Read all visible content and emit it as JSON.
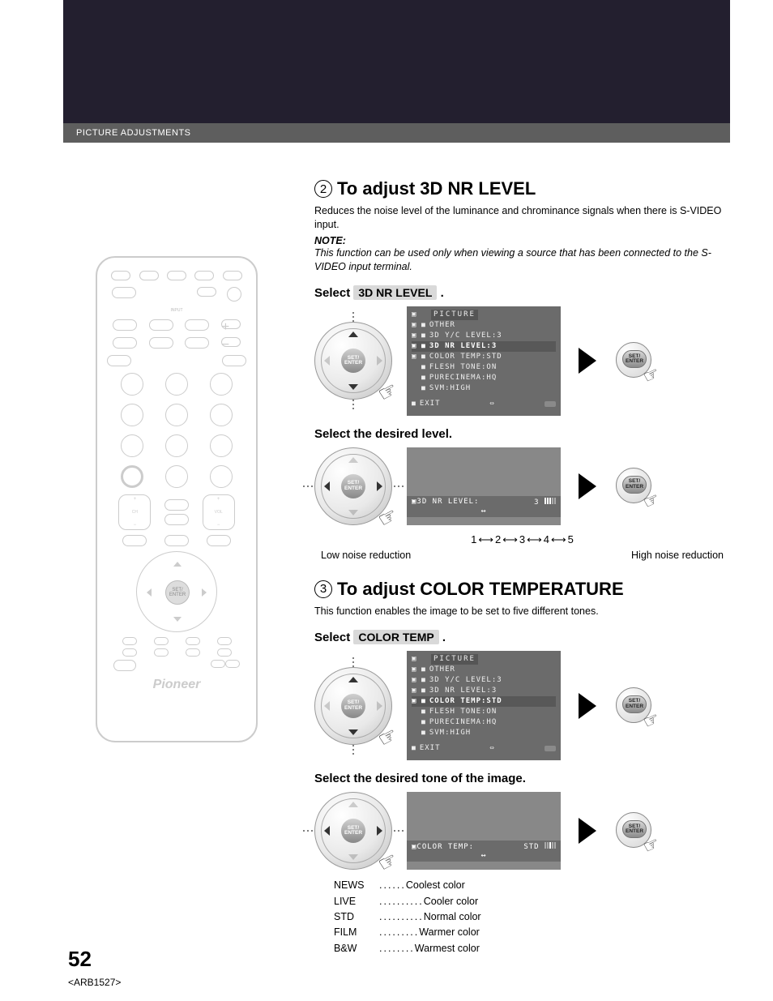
{
  "header": {
    "breadcrumb": "PICTURE ADJUSTMENTS"
  },
  "remote": {
    "brand": "Pioneer",
    "dpad_center": "SET/\nENTER"
  },
  "section2": {
    "num": "2",
    "title": "To adjust 3D NR LEVEL",
    "body": "Reduces the noise level of the luminance and chrominance signals when there is S-VIDEO input.",
    "note_label": "NOTE:",
    "note_body": "This function can be used only when viewing a source that has been connected to the S-VIDEO input terminal.",
    "select_prefix": "Select",
    "select_chip": "3D NR LEVEL",
    "select_suffix": ".",
    "dpad_center": "SET/\nENTER",
    "enter_label": "SET/\nENTER",
    "osd1": {
      "header": "PICTURE",
      "lines": [
        "OTHER",
        "3D Y/C LEVEL:3",
        "3D NR LEVEL:3",
        "COLOR TEMP:STD",
        "FLESH TONE:ON",
        "PURECINEMA:HQ",
        "SVM:HIGH"
      ],
      "highlight_index": 2,
      "exit": "EXIT"
    },
    "sub2": "Select the desired level.",
    "osd2": {
      "label": "3D NR LEVEL:",
      "value": "3",
      "arrows": "↔"
    },
    "scale": {
      "v1": "1",
      "v2": "2",
      "v3": "3",
      "v4": "4",
      "v5": "5"
    },
    "scale_low": "Low noise reduction",
    "scale_high": "High noise reduction"
  },
  "section3": {
    "num": "3",
    "title": "To adjust COLOR TEMPERATURE",
    "body": "This function enables the image to be set to five different tones.",
    "select_prefix": "Select",
    "select_chip": "COLOR TEMP",
    "select_suffix": ".",
    "dpad_center": "SET/\nENTER",
    "enter_label": "SET/\nENTER",
    "osd1": {
      "header": "PICTURE",
      "lines": [
        "OTHER",
        "3D Y/C LEVEL:3",
        "3D NR LEVEL:3",
        "COLOR TEMP:STD",
        "FLESH TONE:ON",
        "PURECINEMA:HQ",
        "SVM:HIGH"
      ],
      "highlight_index": 3,
      "exit": "EXIT"
    },
    "sub2": "Select the desired tone of the image.",
    "osd2": {
      "label": "COLOR TEMP:",
      "value": "STD",
      "arrows": "↔"
    },
    "tones": [
      {
        "k": "NEWS",
        "d": "......",
        "v": "Coolest color"
      },
      {
        "k": "LIVE",
        "d": "..........",
        "v": "Cooler color"
      },
      {
        "k": "STD",
        "d": "..........",
        "v": "Normal color"
      },
      {
        "k": "FILM",
        "d": ".........",
        "v": "Warmer color"
      },
      {
        "k": "B&W",
        "d": "........",
        "v": "Warmest color"
      }
    ]
  },
  "footer": {
    "page": "52",
    "code": "<ARB1527>"
  }
}
